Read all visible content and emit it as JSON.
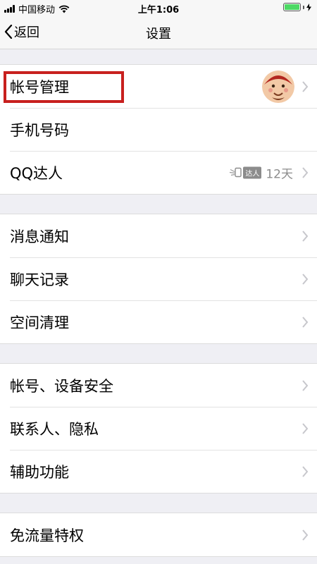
{
  "status": {
    "carrier": "中国移动",
    "time": "上午1:06"
  },
  "nav": {
    "back_label": "返回",
    "title": "设置"
  },
  "group1": {
    "account": "帐号管理",
    "phone": "手机号码",
    "qq_expert": "QQ达人",
    "badge_label": "达人",
    "days": "12天"
  },
  "group2": {
    "notify": "消息通知",
    "chat_history": "聊天记录",
    "storage_clean": "空间清理"
  },
  "group3": {
    "security": "帐号、设备安全",
    "privacy": "联系人、隐私",
    "accessibility": "辅助功能"
  },
  "group4": {
    "free_data": "免流量特权"
  },
  "colors": {
    "highlight": "#c8201e",
    "battery": "#4cd964",
    "background": "#efeff4"
  }
}
